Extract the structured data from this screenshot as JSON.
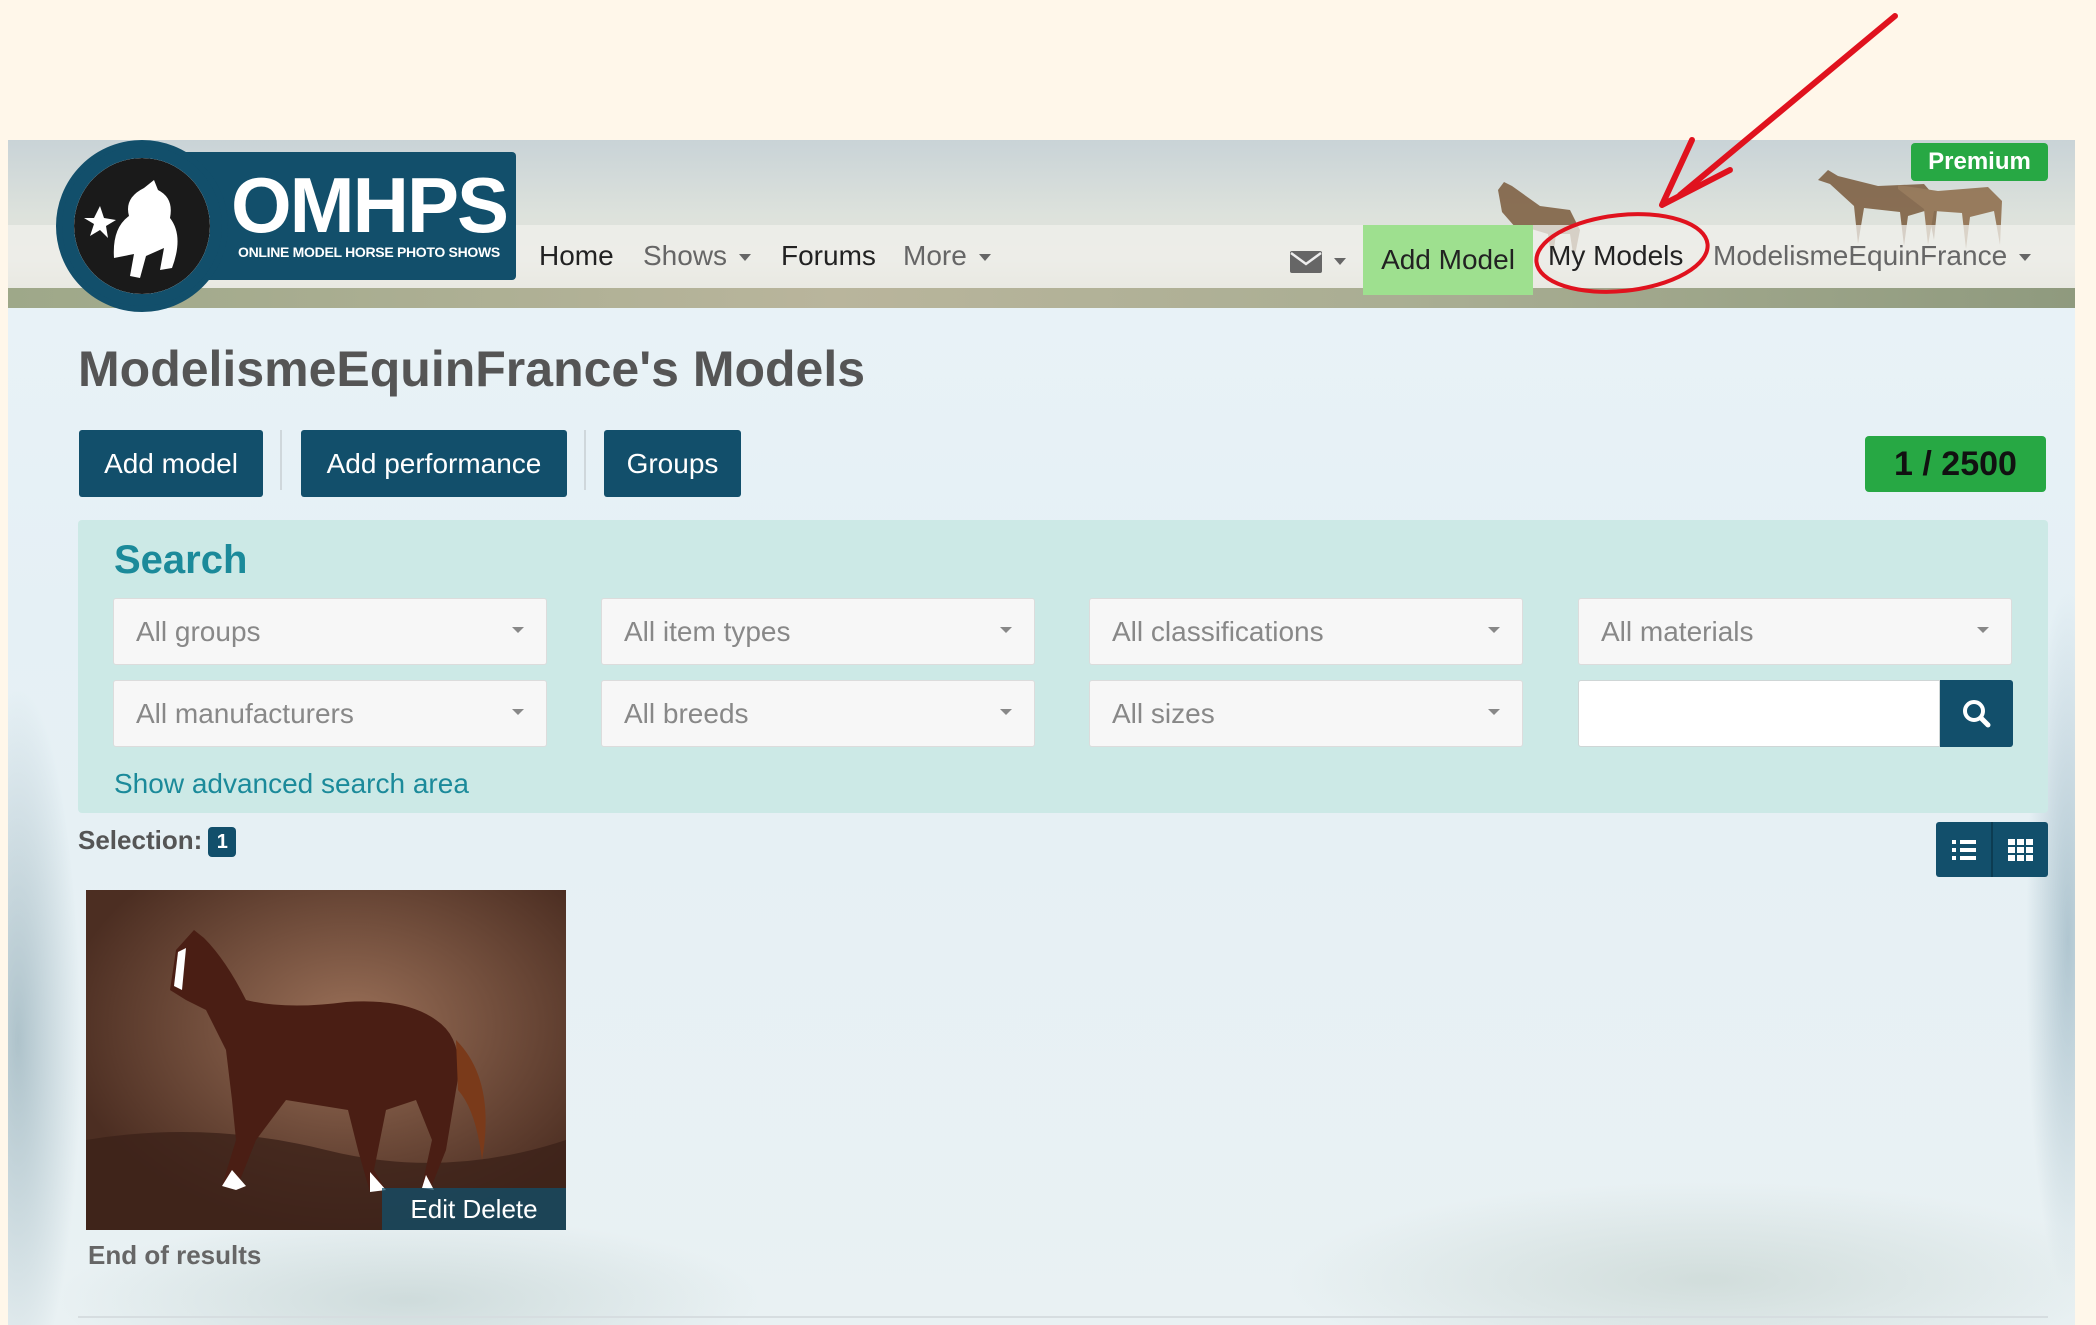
{
  "navbar": {
    "brand": "OMHPS",
    "brand_sub": "ONLINE MODEL HORSE PHOTO SHOWS",
    "items": [
      {
        "label": "Home"
      },
      {
        "label": "Shows"
      },
      {
        "label": "Forums"
      },
      {
        "label": "More"
      }
    ],
    "add_model": "Add Model",
    "my_models": "My Models",
    "user": "ModelismeEquinFrance",
    "premium": "Premium",
    "mail_icon": "envelope-icon"
  },
  "page": {
    "title": "ModelismeEquinFrance's Models",
    "buttons": {
      "add_model": "Add model",
      "add_performance": "Add performance",
      "groups": "Groups"
    },
    "counter": "1 / 2500"
  },
  "search": {
    "title": "Search",
    "selects": [
      "All groups",
      "All item types",
      "All classifications",
      "All materials",
      "All manufacturers",
      "All breeds",
      "All sizes"
    ],
    "input_value": "",
    "advanced_link": "Show advanced search area"
  },
  "results": {
    "selection_label": "Selection:",
    "selection_count": "1",
    "card_actions": {
      "edit": "Edit",
      "delete": "Delete"
    },
    "end_text": "End of results"
  },
  "colors": {
    "primary": "#124f6b",
    "success": "#27a844",
    "search_bg": "#cce9e6",
    "annotation": "#e0121e"
  }
}
